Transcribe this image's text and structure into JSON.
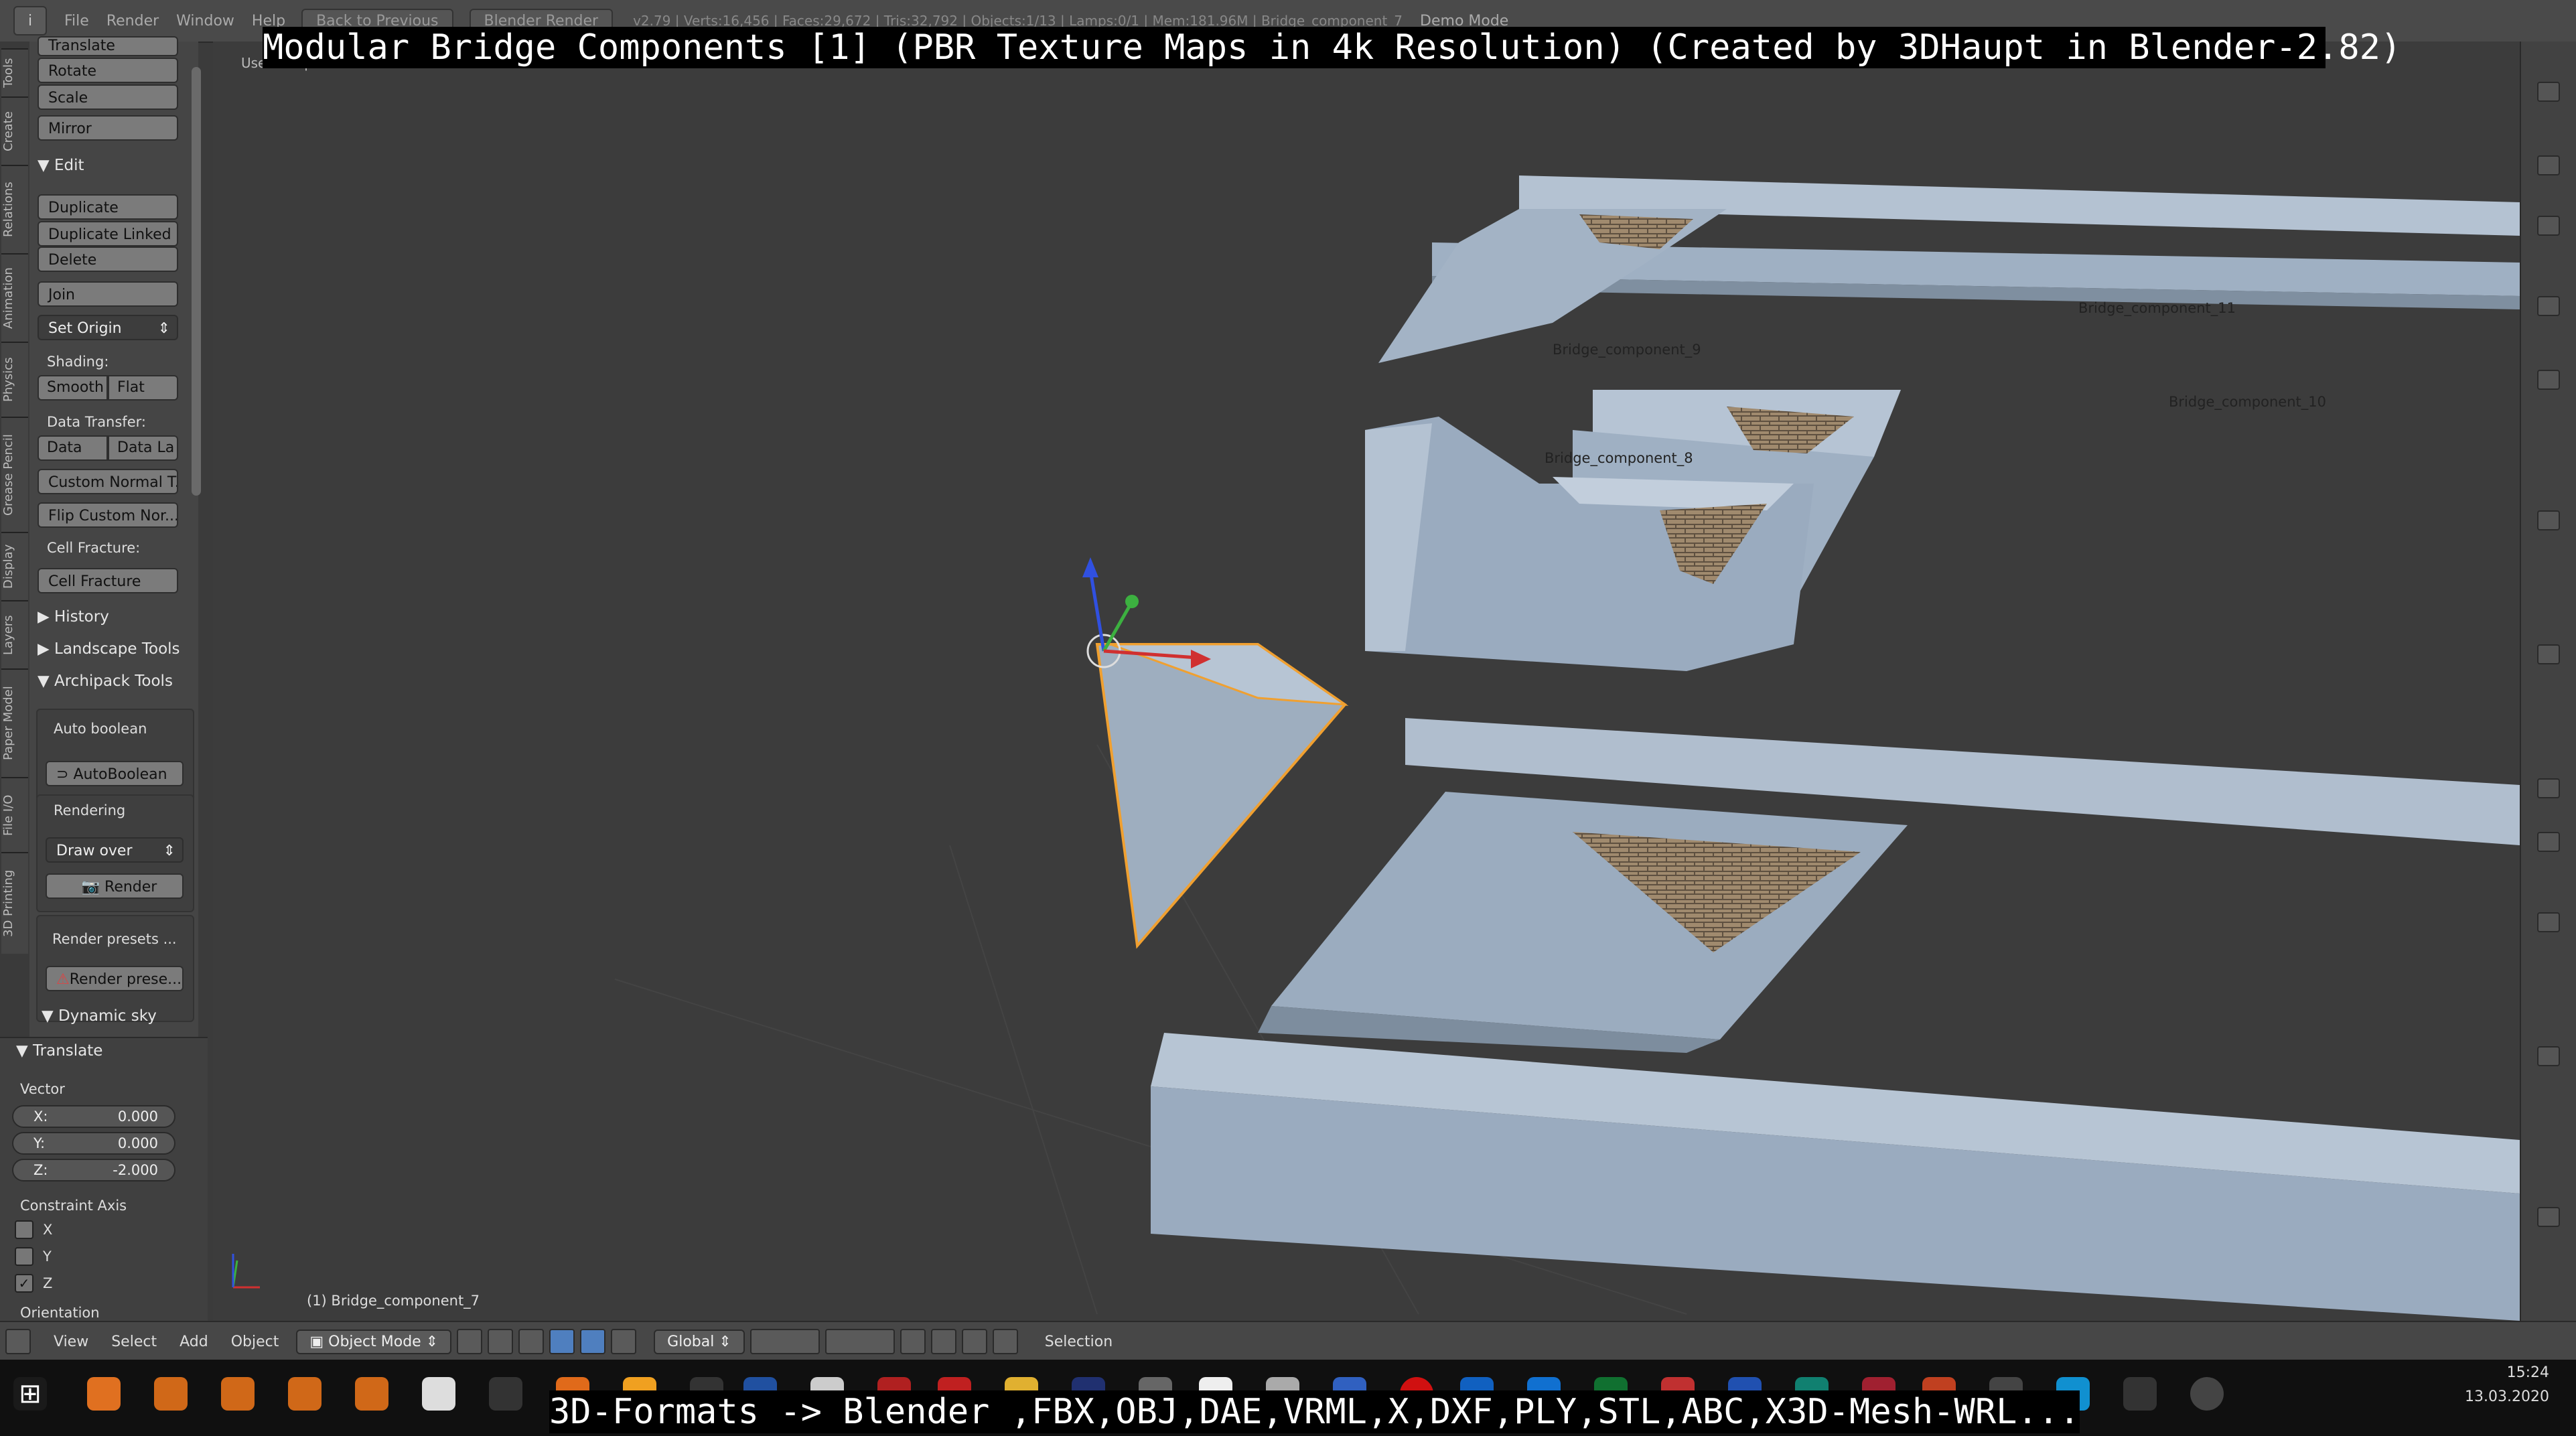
{
  "topbar": {
    "menu": [
      "File",
      "Render",
      "Window",
      "Help"
    ],
    "back_button": "Back to Previous",
    "engine": "Blender Render",
    "stats": "v2.79 | Verts:16,456 | Faces:29,672 | Tris:32,792 | Objects:1/13 | Lamps:0/1 | Mem:181.96M | Bridge_component_7",
    "mode": "Demo Mode"
  },
  "overlay": {
    "title": "Modular Bridge Components [1] (PBR Texture Maps in 4k Resolution) (Created by 3DHaupt in Blender-2.82)",
    "bottom": "3D-Formats -> Blender ,FBX,OBJ,DAE,VRML,X,DXF,PLY,STL,ABC,X3D-Mesh-WRL..."
  },
  "vtabs": [
    "Tools",
    "Create",
    "Relations",
    "Animation",
    "Physics",
    "Grease Pencil",
    "Display",
    "Layers",
    "Paper Model",
    "File I/O",
    "3D Printing"
  ],
  "toolshelf": {
    "translate": "Translate",
    "rotate": "Rotate",
    "scale": "Scale",
    "mirror": "Mirror",
    "edit_header": "Edit",
    "duplicate": "Duplicate",
    "duplicate_linked": "Duplicate Linked",
    "delete": "Delete",
    "join": "Join",
    "set_origin": "Set Origin",
    "shading_label": "Shading:",
    "smooth": "Smooth",
    "flat": "Flat",
    "data_transfer_label": "Data Transfer:",
    "data": "Data",
    "data_layout": "Data La",
    "custom_normal": "Custom Normal T...",
    "flip_custom": "Flip Custom Nor...",
    "cell_fracture_label": "Cell Fracture:",
    "cell_fracture": "Cell Fracture",
    "history": "History",
    "landscape_tools": "Landscape Tools",
    "archipack_tools": "Archipack Tools",
    "auto_boolean_label": "Auto boolean",
    "auto_boolean": "AutoBoolean",
    "rendering_label": "Rendering",
    "draw_over": "Draw over",
    "render": "Render",
    "render_presets_label": "Render presets ...",
    "render_presets": "Render prese...",
    "dynamic_sky": "Dynamic sky"
  },
  "operator": {
    "header": "Translate",
    "vector_label": "Vector",
    "x_label": "X:",
    "x_value": "0.000",
    "y_label": "Y:",
    "y_value": "0.000",
    "z_label": "Z:",
    "z_value": "-2.000",
    "constraint_label": "Constraint Axis",
    "cx": "X",
    "cy": "Y",
    "cz": "Z",
    "cz_checked": true,
    "orientation_label": "Orientation"
  },
  "viewport": {
    "view_label": "User Persp",
    "object_label": "(1) Bridge_component_7",
    "labels": [
      "Bridge_component_11",
      "Bridge_component_10",
      "Bridge_component_9",
      "Bridge_component_8"
    ]
  },
  "header3d": {
    "menu": [
      "View",
      "Select",
      "Add",
      "Object"
    ],
    "mode": "Object Mode",
    "orientation": "Global",
    "status": "Selection"
  },
  "taskbar": {
    "time": "15:24",
    "date": "13.03.2020"
  },
  "colors": {
    "concrete": "#9fb0c3",
    "brick": "#a08a6e",
    "selection": "#f0a030",
    "viewport_bg": "#3c3c3c"
  }
}
